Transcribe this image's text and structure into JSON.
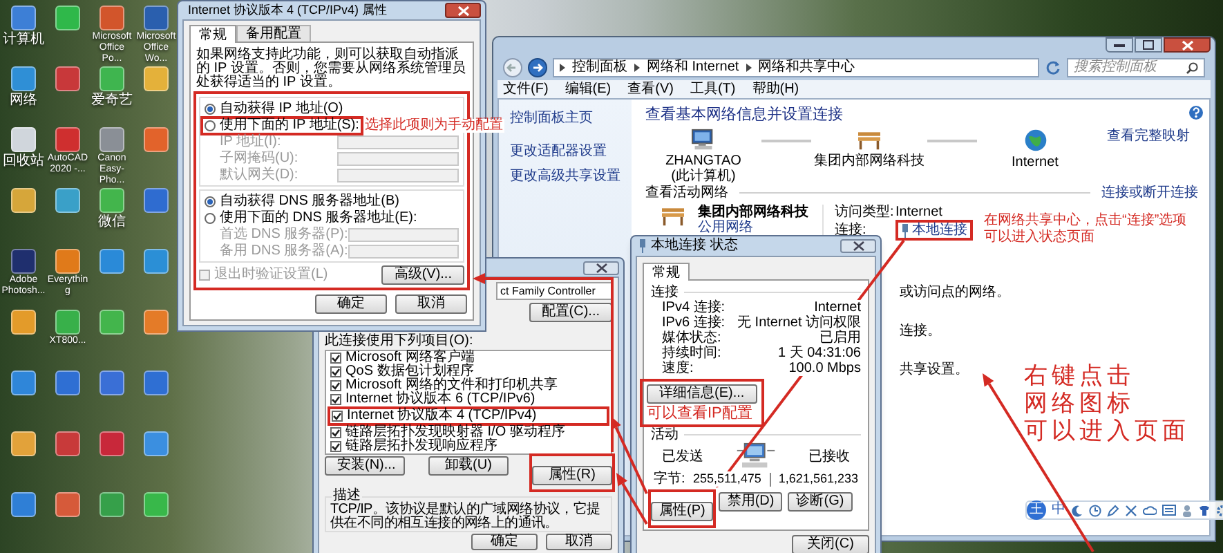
{
  "desktop": {
    "icon_labels": [
      "计算机",
      "Microsoft Office Po...",
      "Microsoft Office Wo...",
      "网络",
      "爱奇艺",
      "回收站",
      "AutoCAD 2020 -...",
      "Canon Easy-Pho...",
      "微信",
      "Adobe Photosh...",
      "Everything",
      "XT800..."
    ]
  },
  "network_center": {
    "breadcrumb": [
      "控制面板",
      "网络和 Internet",
      "网络和共享中心"
    ],
    "search_placeholder": "搜索控制面板",
    "menu": [
      "文件(F)",
      "编辑(E)",
      "查看(V)",
      "工具(T)",
      "帮助(H)"
    ],
    "sidebar": [
      "控制面板主页",
      "更改适配器设置",
      "更改高级共享设置"
    ],
    "heading": "查看基本网络信息并设置连接",
    "full_map_link": "查看完整映射",
    "map": [
      {
        "kind": "computer",
        "label": "ZHANGTAO",
        "sublabel": "(此计算机)"
      },
      {
        "kind": "network",
        "label": "集团内部网络科技"
      },
      {
        "kind": "internet",
        "label": "Internet"
      }
    ],
    "active_header": "查看活动网络",
    "connect_link": "连接或断开连接",
    "active_network": {
      "name": "集团内部网络科技",
      "type": "公用网络",
      "access_label": "访问类型:",
      "access_value": "Internet",
      "connection_label": "连接:",
      "connection_value": "本地连接"
    },
    "fragments": [
      "或访问点的网络。",
      "连接。",
      "共享设置。"
    ]
  },
  "properties_dialog": {
    "adapter": "ct Family Controller",
    "configure_button": "配置(C)...",
    "items_label": "此连接使用下列项目(O):",
    "items": [
      {
        "label": "Microsoft 网络客户端",
        "checked": true
      },
      {
        "label": "QoS 数据包计划程序",
        "checked": true
      },
      {
        "label": "Microsoft 网络的文件和打印机共享",
        "checked": true
      },
      {
        "label": "Internet 协议版本 6 (TCP/IPv6)",
        "checked": true
      },
      {
        "label": "Internet 协议版本 4 (TCP/IPv4)",
        "checked": true
      },
      {
        "label": "链路层拓扑发现映射器 I/O 驱动程序",
        "checked": true
      },
      {
        "label": "链路层拓扑发现响应程序",
        "checked": true
      }
    ],
    "action_buttons": [
      "安装(N)...",
      "卸载(U)",
      "属性(R)"
    ],
    "description_label": "描述",
    "description": "TCP/IP。该协议是默认的广域网络协议，它提供在不同的相互连接的网络上的通讯。",
    "buttons": [
      "确定",
      "取消"
    ]
  },
  "status_dialog": {
    "title": "本地连接 状态",
    "tab": "常规",
    "connection_header": "连接",
    "rows": [
      {
        "label": "IPv4 连接:",
        "value": "Internet"
      },
      {
        "label": "IPv6 连接:",
        "value": "无 Internet 访问权限"
      },
      {
        "label": "媒体状态:",
        "value": "已启用"
      },
      {
        "label": "持续时间:",
        "value": "1 天 04:31:06"
      },
      {
        "label": "速度:",
        "value": "100.0 Mbps"
      }
    ],
    "details_button": "详细信息(E)...",
    "activity_header": "活动",
    "sent_label": "已发送",
    "received_label": "已接收",
    "bytes_label": "字节:",
    "bytes_sent": "255,511,475",
    "bytes_received": "1,621,561,233",
    "buttons": [
      "属性(P)",
      "禁用(D)",
      "诊断(G)"
    ],
    "close_button": "关闭(C)"
  },
  "tcp_dialog": {
    "title": "Internet 协议版本 4 (TCP/IPv4) 属性",
    "tabs": [
      {
        "label": "常规",
        "selected": true
      },
      {
        "label": "备用配置",
        "selected": false
      }
    ],
    "description": "如果网络支持此功能，则可以获取自动指派的 IP 设置。否则，您需要从网络系统管理员处获得适当的 IP 设置。",
    "ip_options": [
      {
        "label": "自动获得 IP 地址(O)",
        "selected": true
      },
      {
        "label": "使用下面的 IP 地址(S):",
        "selected": false
      }
    ],
    "ip_fields": [
      {
        "label": "IP 地址(I):",
        "disabled": true
      },
      {
        "label": "子网掩码(U):",
        "disabled": true
      },
      {
        "label": "默认网关(D):",
        "disabled": true
      }
    ],
    "dns_options": [
      {
        "label": "自动获得 DNS 服务器地址(B)",
        "selected": true
      },
      {
        "label": "使用下面的 DNS 服务器地址(E):",
        "selected": false
      }
    ],
    "dns_fields": [
      {
        "label": "首选 DNS 服务器(P):",
        "disabled": true
      },
      {
        "label": "备用 DNS 服务器(A):",
        "disabled": true
      }
    ],
    "validate": {
      "label": "退出时验证设置(L)",
      "checked": false,
      "disabled": true
    },
    "advanced_button": "高级(V)...",
    "buttons": [
      "确定",
      "取消"
    ]
  },
  "annotations": {
    "manual_config": "选择此项则为手动配置",
    "status_page": [
      "在网络共享中心，点击“连接”选项",
      "可以进入状态页面"
    ],
    "ip_config": "可以查看IP配置",
    "right_click": [
      "右键点击",
      "网络图标",
      "可以进入页面"
    ]
  },
  "ime_bar": {
    "logo": "王",
    "mode": "中"
  }
}
